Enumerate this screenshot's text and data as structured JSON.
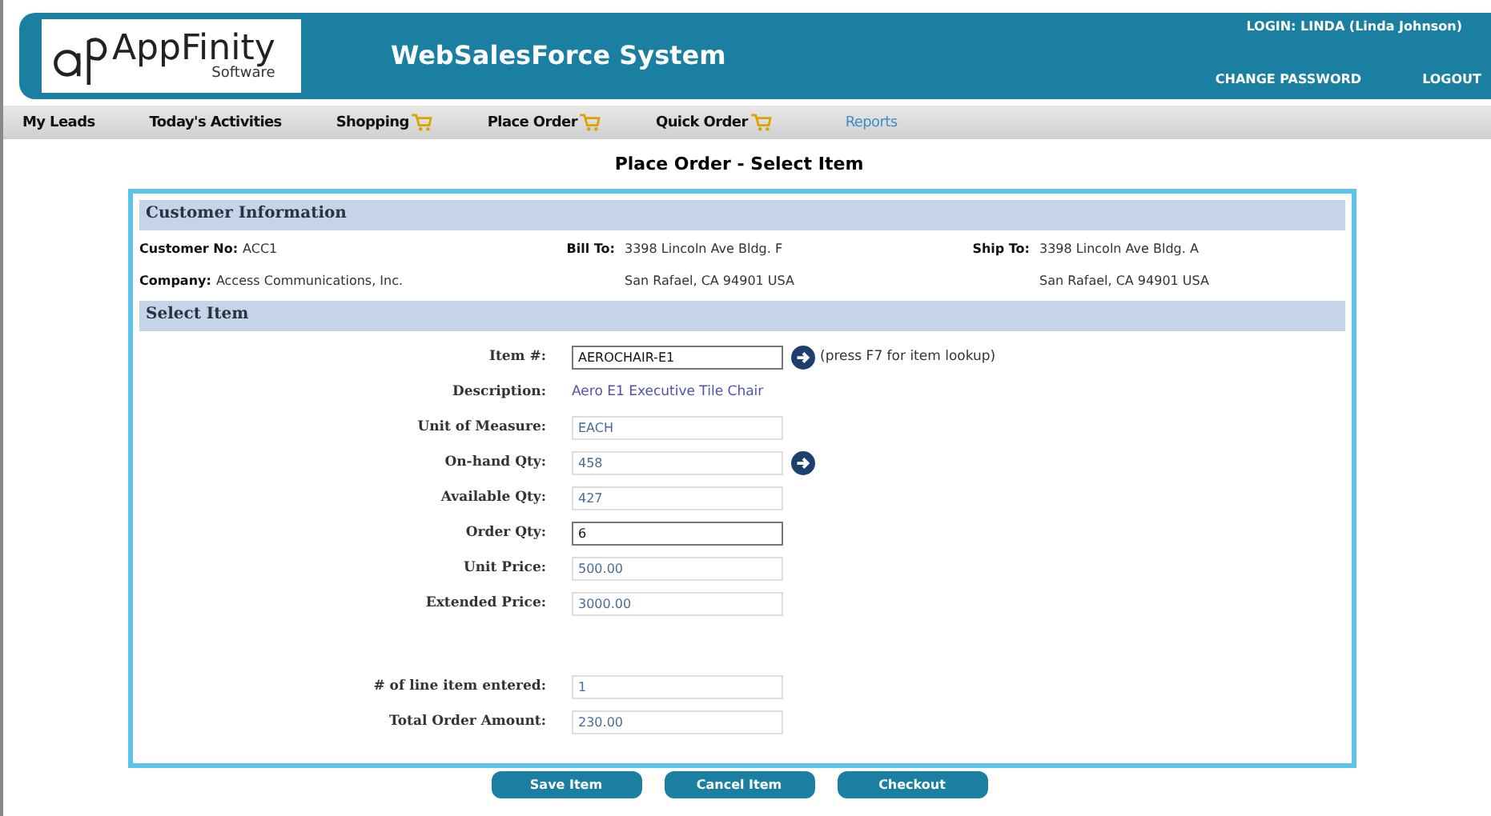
{
  "header": {
    "logo_text": "AppFinity",
    "logo_sub": "Software",
    "system_title": "WebSalesForce System",
    "login": "LOGIN: LINDA (Linda Johnson)",
    "links": [
      "CHANGE PASSWORD",
      "LOGOUT"
    ]
  },
  "nav": [
    {
      "label": "My Leads",
      "cart": false,
      "selected": false
    },
    {
      "label": "Today's Activities",
      "cart": false,
      "selected": false
    },
    {
      "label": "Shopping",
      "cart": true,
      "selected": false
    },
    {
      "label": "Place Order",
      "cart": true,
      "selected": false
    },
    {
      "label": "Quick Order",
      "cart": true,
      "selected": false
    },
    {
      "label": "Reports",
      "cart": false,
      "selected": true
    }
  ],
  "page_title": "Place Order - Select Item",
  "customer": {
    "heading": "Customer Information",
    "customer_no": {
      "label": "Customer No:",
      "value": "ACC1"
    },
    "company": {
      "label": "Company:",
      "value": "Access Communications, Inc."
    },
    "bill_to": {
      "label": "Bill To:",
      "lines": [
        "3398 Lincoln Ave Bldg. F",
        "San Rafael, CA 94901  USA"
      ]
    },
    "ship_to": {
      "label": "Ship To:",
      "lines": [
        "3398 Lincoln Ave Bldg. A",
        "San Rafael, CA 94901 USA"
      ]
    }
  },
  "select_item": {
    "heading": "Select Item",
    "rows": [
      {
        "label": "Item #:",
        "kind": "input",
        "value": "AEROCHAIR-E1",
        "arrow": true,
        "hint": "(press F7 for item lookup)"
      },
      {
        "label": "Description:",
        "kind": "text",
        "value": "Aero E1 Executive Tile Chair"
      },
      {
        "label": "Unit of Measure:",
        "kind": "readonly",
        "value": "EACH"
      },
      {
        "label": "On-hand Qty:",
        "kind": "readonly",
        "value": "458",
        "arrow": true
      },
      {
        "label": "Available Qty:",
        "kind": "readonly",
        "value": "427"
      },
      {
        "label": "Order Qty:",
        "kind": "input",
        "value": "6"
      },
      {
        "label": "Unit Price:",
        "kind": "readonly",
        "value": "500.00"
      },
      {
        "label": "Extended Price:",
        "kind": "readonly",
        "value": "3000.00"
      }
    ],
    "summary_rows": [
      {
        "label": "# of line item entered:",
        "kind": "readonly",
        "value": "1"
      },
      {
        "label": "Total Order Amount:",
        "kind": "readonly",
        "value": "230.00"
      }
    ]
  },
  "buttons": [
    "Save Item",
    "Cancel Item",
    "Checkout"
  ]
}
